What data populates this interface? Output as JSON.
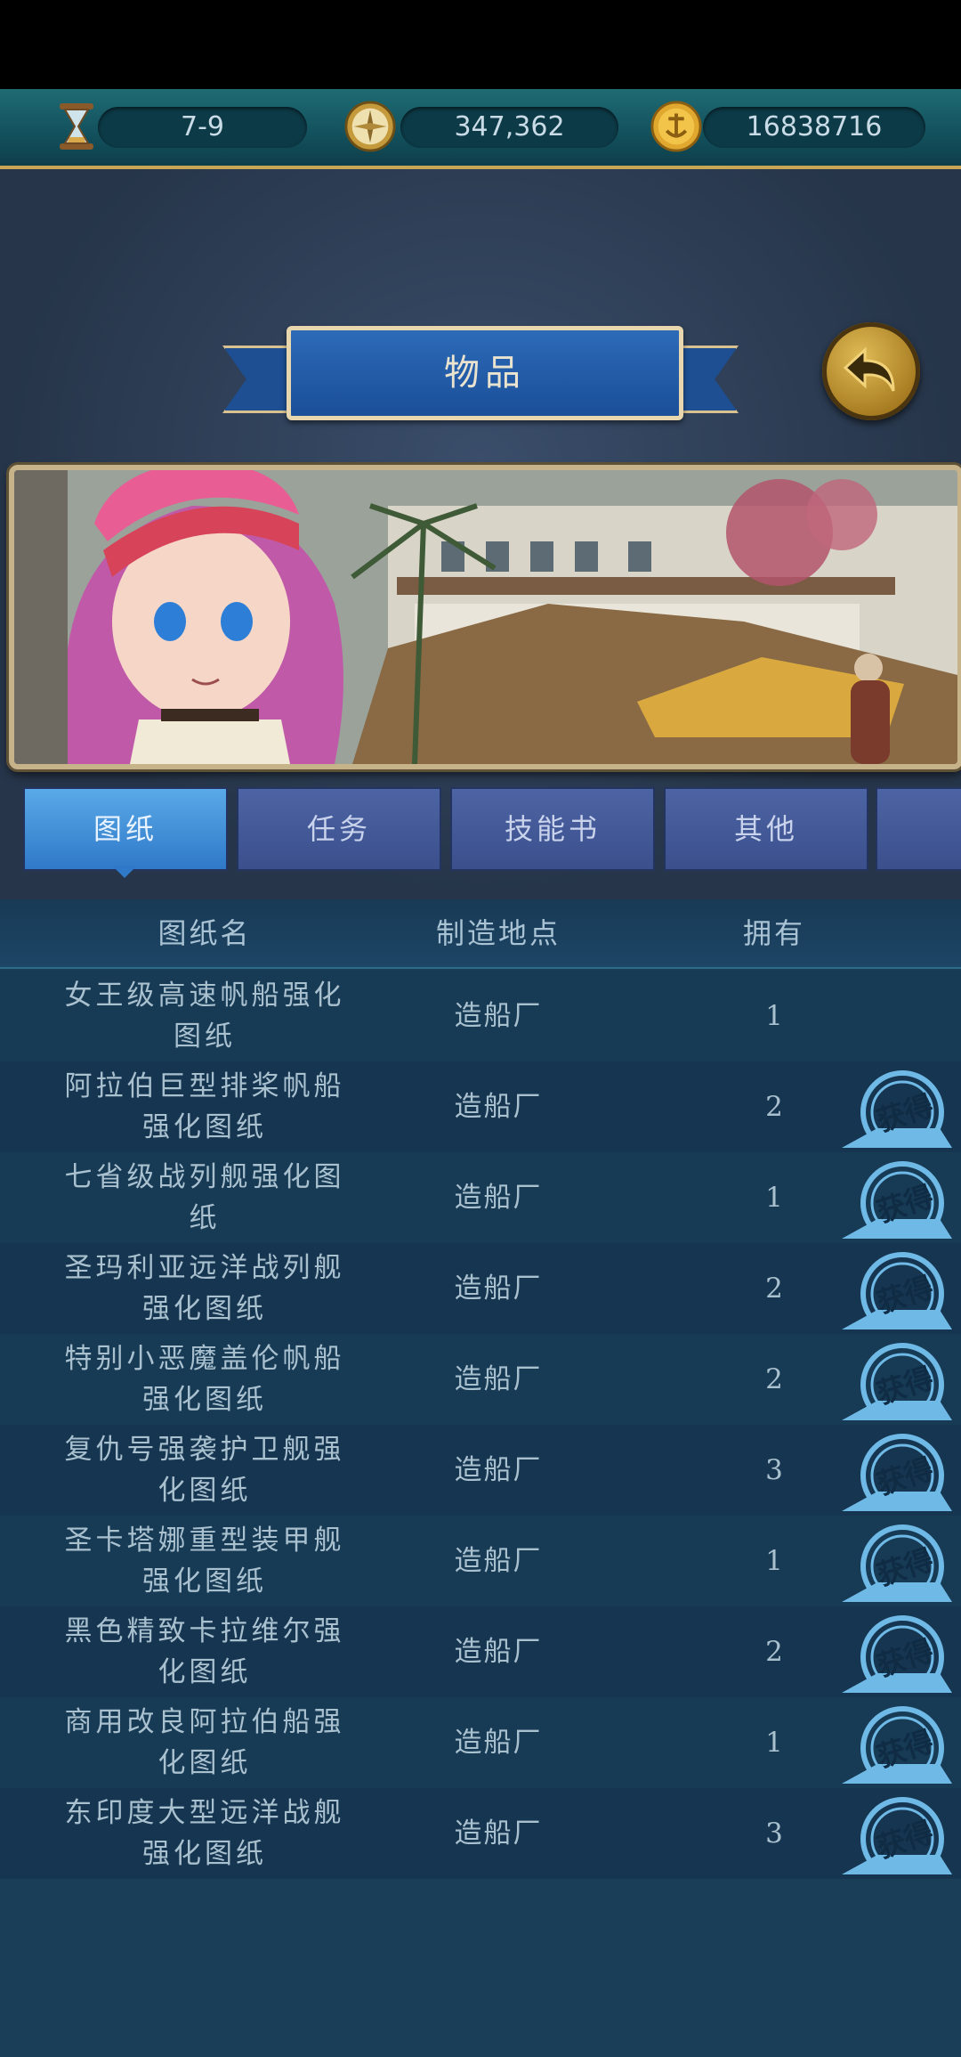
{
  "resources": [
    {
      "icon": "hourglass-icon",
      "value": "7-9"
    },
    {
      "icon": "compass-icon",
      "value": "347,362"
    },
    {
      "icon": "anchor-coin-icon",
      "value": "16838716"
    }
  ],
  "title": "物品",
  "tabs": [
    {
      "label": "图纸",
      "active": true
    },
    {
      "label": "任务",
      "active": false
    },
    {
      "label": "技能书",
      "active": false
    },
    {
      "label": "其他",
      "active": false
    },
    {
      "label": "",
      "active": false
    }
  ],
  "table": {
    "headers": [
      "图纸名",
      "制造地点",
      "拥有"
    ],
    "rows": [
      {
        "name": "女王级高速帆船强化图纸",
        "location": "造船厂",
        "owned": "1",
        "button": ""
      },
      {
        "name": "阿拉伯巨型排桨帆船强化图纸",
        "location": "造船厂",
        "owned": "2",
        "button": "获得"
      },
      {
        "name": "七省级战列舰强化图纸",
        "location": "造船厂",
        "owned": "1",
        "button": "获得"
      },
      {
        "name": "圣玛利亚远洋战列舰强化图纸",
        "location": "造船厂",
        "owned": "2",
        "button": "获得"
      },
      {
        "name": "特别小恶魔盖伦帆船强化图纸",
        "location": "造船厂",
        "owned": "2",
        "button": "获得"
      },
      {
        "name": "复仇号强袭护卫舰强化图纸",
        "location": "造船厂",
        "owned": "3",
        "button": "获得"
      },
      {
        "name": "圣卡塔娜重型装甲舰强化图纸",
        "location": "造船厂",
        "owned": "1",
        "button": "获得"
      },
      {
        "name": "黑色精致卡拉维尔强化图纸",
        "location": "造船厂",
        "owned": "2",
        "button": "获得"
      },
      {
        "name": "商用改良阿拉伯船强化图纸",
        "location": "造船厂",
        "owned": "1",
        "button": "获得"
      },
      {
        "name": "东印度大型远洋战舰强化图纸",
        "location": "造船厂",
        "owned": "3",
        "button": "获得"
      }
    ]
  },
  "colors": {
    "accent": "#2f79c8",
    "gold": "#c9a656",
    "stamp": "#6fb9e6"
  }
}
